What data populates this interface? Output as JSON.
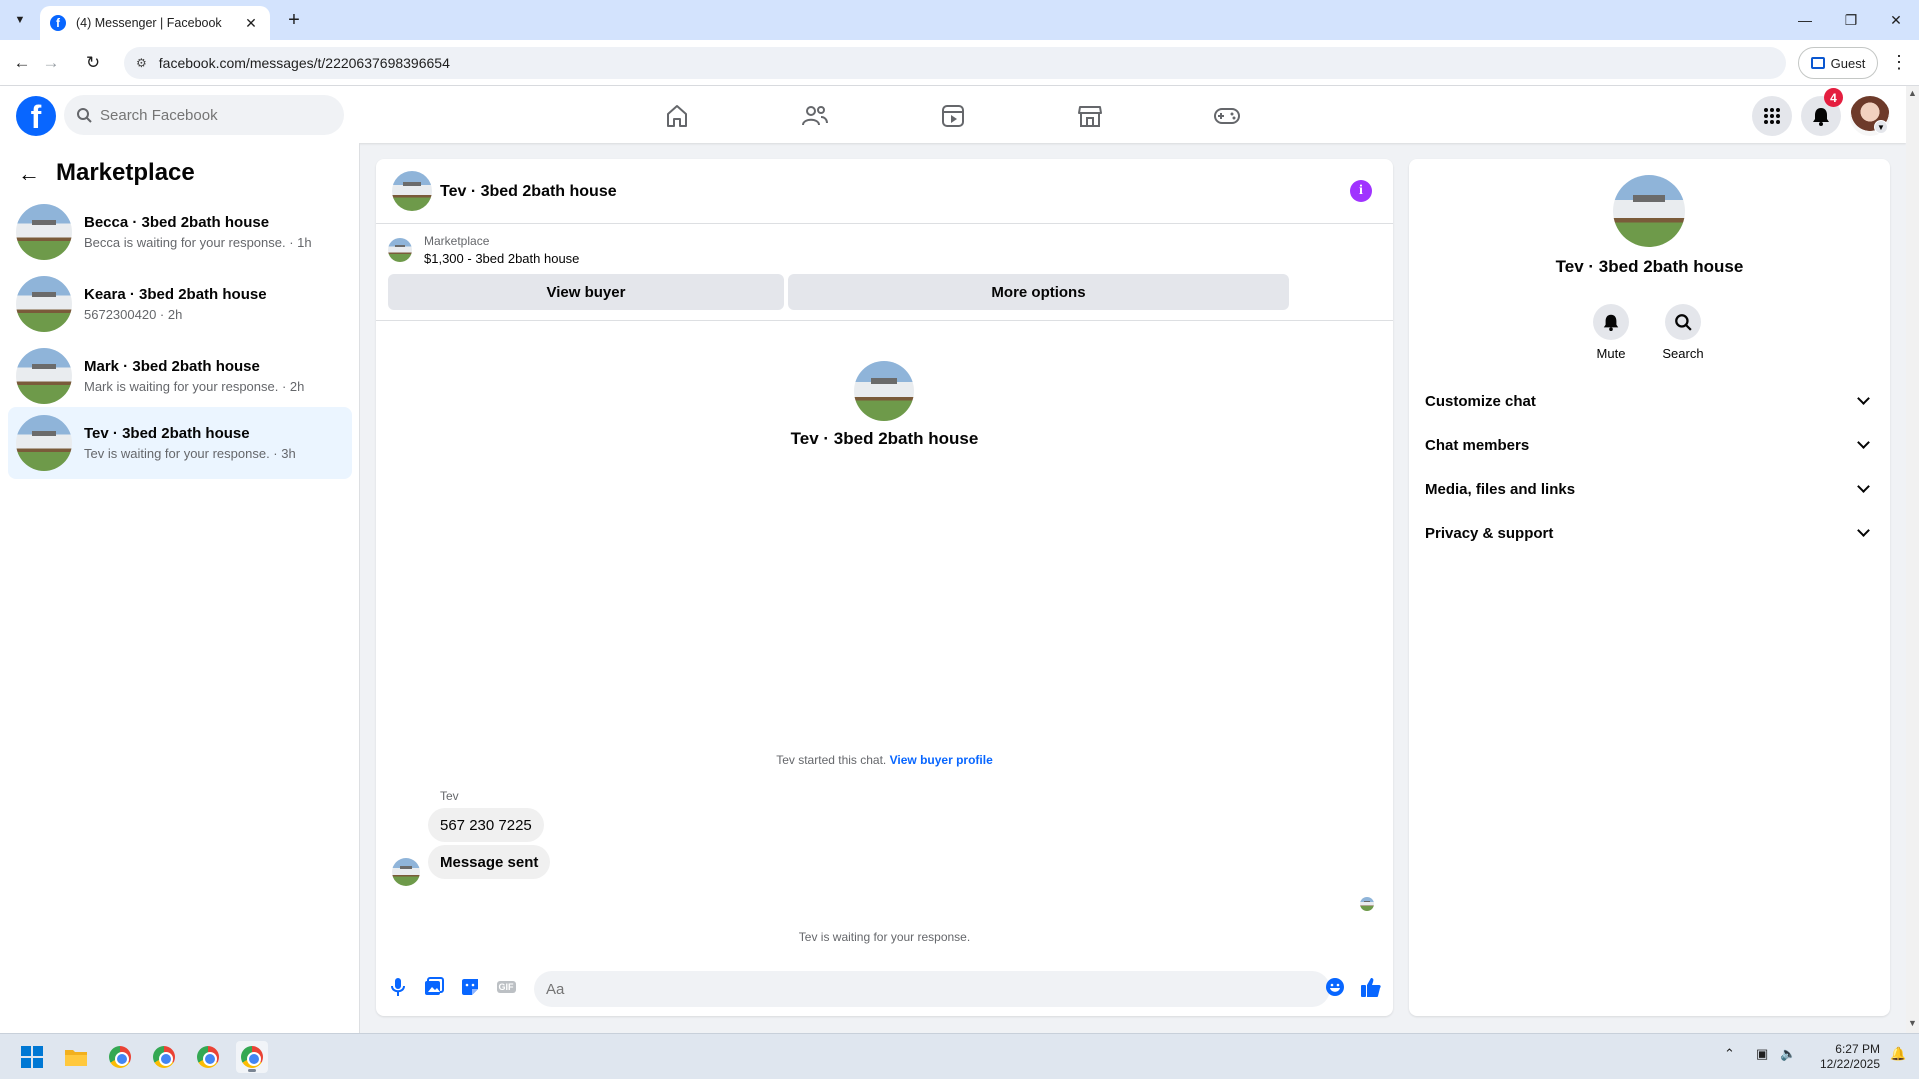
{
  "browser": {
    "tab_title": "(4) Messenger | Facebook",
    "url": "facebook.com/messages/t/2220637698396654",
    "profile_label": "Guest"
  },
  "header": {
    "search_placeholder": "Search Facebook",
    "notification_count": "4",
    "brand_color": "#0866ff"
  },
  "sidebar": {
    "title": "Marketplace",
    "conversations": [
      {
        "name": "Becca · 3bed 2bath house",
        "preview": "Becca is waiting for your response. · 1h",
        "active": false
      },
      {
        "name": "Keara · 3bed 2bath house",
        "preview": "5672300420 · 2h",
        "active": false
      },
      {
        "name": "Mark · 3bed 2bath house",
        "preview": "Mark is waiting for your response. · 2h",
        "active": false
      },
      {
        "name": "Tev · 3bed 2bath house",
        "preview": "Tev is waiting for your response. · 3h",
        "active": true
      }
    ]
  },
  "chat": {
    "title": "Tev · 3bed 2bath house",
    "marketplace_label": "Marketplace",
    "listing": "$1,300 - 3bed 2bath house",
    "view_buyer_label": "View buyer",
    "more_options_label": "More options",
    "center_name": "Tev · 3bed 2bath house",
    "started_text": "Tev started this chat.",
    "view_buyer_profile_link": "View buyer profile",
    "sender_name": "Tev",
    "messages": [
      "567 230 7225",
      "Message sent"
    ],
    "waiting_text": "Tev is waiting for your response.",
    "composer_placeholder": "Aa",
    "gif_label": "GIF"
  },
  "details_panel": {
    "name": "Tev · 3bed 2bath house",
    "actions": [
      {
        "label": "Mute",
        "icon": "bell-icon"
      },
      {
        "label": "Search",
        "icon": "search-icon"
      }
    ],
    "sections": [
      "Customize chat",
      "Chat members",
      "Media, files and links",
      "Privacy & support"
    ]
  },
  "taskbar": {
    "time": "6:27 PM",
    "date": "12/22/2025"
  }
}
